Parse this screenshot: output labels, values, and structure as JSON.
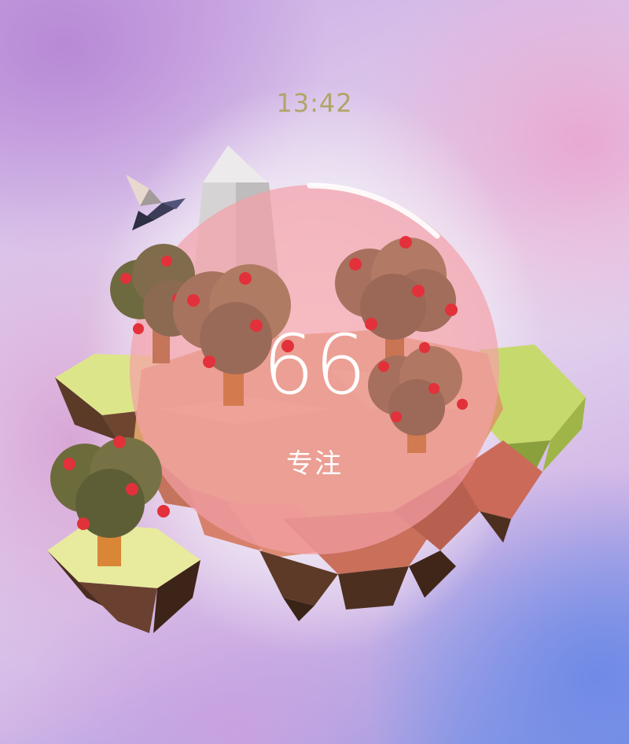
{
  "clock": {
    "time": "13:42"
  },
  "timer": {
    "value": "66",
    "status": "专注",
    "progress": 0.12
  },
  "scene": {
    "ring_color": "#f2a3aa",
    "fruit_color": "#e2313a",
    "icons": [
      "bird-icon",
      "obelisk-icon",
      "apple-tree-icon",
      "floating-island-icon"
    ]
  }
}
